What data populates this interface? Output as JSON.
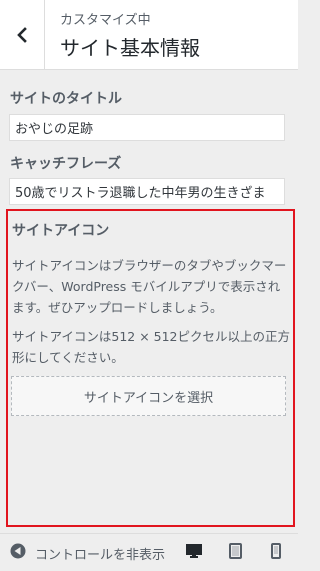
{
  "header": {
    "subtitle": "カスタマイズ中",
    "title": "サイト基本情報",
    "back_icon": "chevron-left-icon"
  },
  "site_title": {
    "label": "サイトのタイトル",
    "value": "おやじの足跡"
  },
  "tagline": {
    "label": "キャッチフレーズ",
    "value": "50歳でリストラ退職した中年男の生きざま"
  },
  "site_icon": {
    "heading": "サイトアイコン",
    "description_1": "サイトアイコンはブラウザーのタブやブックマークバー、WordPress モバイルアプリで表示されます。ぜひアップロードしましょう。",
    "description_2": "サイトアイコンは512 × 512ピクセル以上の正方形にしてください。",
    "select_button": "サイトアイコンを選択"
  },
  "footer": {
    "collapse_label": "コントロールを非表示",
    "collapse_icon": "arrow-left-circle-icon",
    "devices": [
      "desktop-icon",
      "tablet-icon",
      "mobile-icon"
    ]
  },
  "colors": {
    "highlight_border": "#e1141e",
    "panel_background": "#eeeeee",
    "header_background": "#ffffff"
  }
}
